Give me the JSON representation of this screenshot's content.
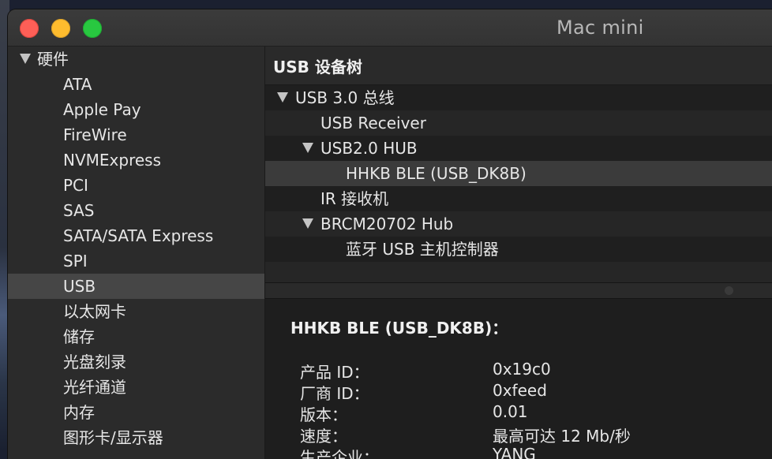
{
  "window": {
    "title": "Mac mini"
  },
  "sidebar": {
    "group_label": "硬件",
    "items": [
      {
        "label": "ATA"
      },
      {
        "label": "Apple Pay"
      },
      {
        "label": "FireWire"
      },
      {
        "label": "NVMExpress"
      },
      {
        "label": "PCI"
      },
      {
        "label": "SAS"
      },
      {
        "label": "SATA/SATA Express"
      },
      {
        "label": "SPI"
      },
      {
        "label": "USB",
        "selected": true
      },
      {
        "label": "以太网卡"
      },
      {
        "label": "储存"
      },
      {
        "label": "光盘刻录"
      },
      {
        "label": "光纤通道"
      },
      {
        "label": "内存"
      },
      {
        "label": "图形卡/显示器"
      }
    ]
  },
  "tree": {
    "header": "USB 设备树",
    "rows": [
      {
        "label": "USB 3.0 总线",
        "expanded": true
      },
      {
        "label": "USB Receiver"
      },
      {
        "label": "USB2.0 HUB",
        "expanded": true
      },
      {
        "label": "HHKB BLE (USB_DK8B)",
        "selected": true
      },
      {
        "label": "IR 接收机"
      },
      {
        "label": "BRCM20702 Hub",
        "expanded": true
      },
      {
        "label": "蓝牙 USB 主机控制器"
      }
    ]
  },
  "detail": {
    "title": "HHKB BLE (USB_DK8B)：",
    "properties": [
      {
        "key": "产品 ID：",
        "value": "0x19c0"
      },
      {
        "key": "厂商 ID：",
        "value": "0xfeed"
      },
      {
        "key": "版本：",
        "value": "0.01"
      },
      {
        "key": "速度：",
        "value": "最高可达 12 Mb/秒"
      },
      {
        "key": "生产企业：",
        "value": "YANG"
      }
    ]
  },
  "colors": {
    "close": "#fd5f57",
    "minimize": "#febc2e",
    "zoom": "#28c840",
    "selection": "#464646"
  }
}
